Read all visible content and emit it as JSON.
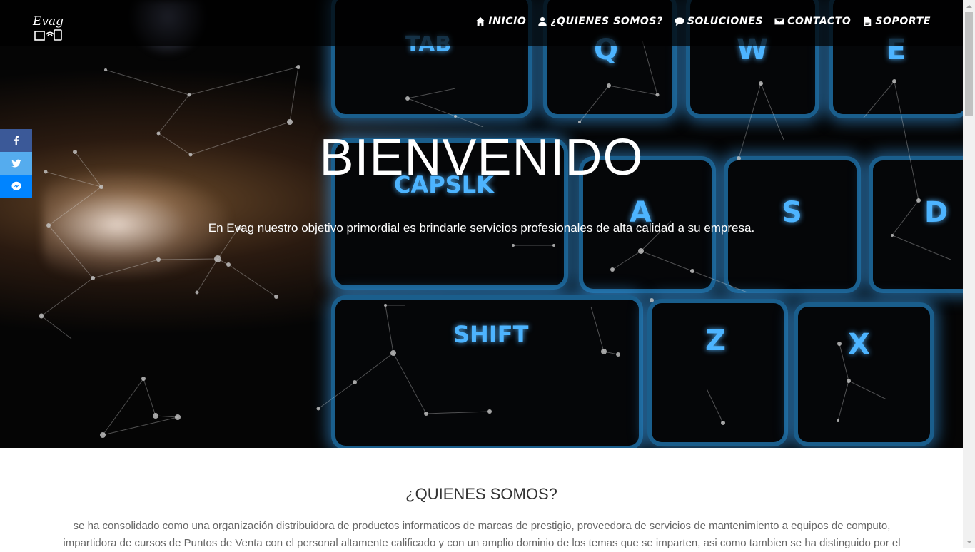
{
  "brand": {
    "logo_text": "Evag"
  },
  "nav": {
    "items": [
      {
        "label": "INICIO",
        "icon": "home-icon"
      },
      {
        "label": "¿QUIENES SOMOS?",
        "icon": "user-icon"
      },
      {
        "label": "SOLUCIONES",
        "icon": "comment-icon"
      },
      {
        "label": "CONTACTO",
        "icon": "envelope-icon"
      },
      {
        "label": "SOPORTE",
        "icon": "document-icon"
      }
    ]
  },
  "hero": {
    "title": "BIENVENIDO",
    "subtitle": "En Evag nuestro objetivo primordial es brindarle servicios profesionales de alta calidad a su empresa.",
    "keys": [
      "TAB",
      "Q",
      "W",
      "E",
      "CAPSLK",
      "A",
      "S",
      "D",
      "SHIFT",
      "Z",
      "X"
    ]
  },
  "social": [
    {
      "name": "facebook",
      "icon": "facebook-icon",
      "color": "#3b5998"
    },
    {
      "name": "twitter",
      "icon": "twitter-icon",
      "color": "#55acee"
    },
    {
      "name": "messenger",
      "icon": "messenger-icon",
      "color": "#0084ff"
    }
  ],
  "about": {
    "title": "¿QUIENES SOMOS?",
    "text": "se ha consolidado como una organización distribuidora de productos informaticos de marcas de prestigio, proveedora de servicios de mantenimiento a equipos de computo, impartidora de cursos de Puntos de Venta con el personal altamente calificado y con un amplio dominio de los temas que se imparten, asi como tambien se ha distinguido por el"
  }
}
